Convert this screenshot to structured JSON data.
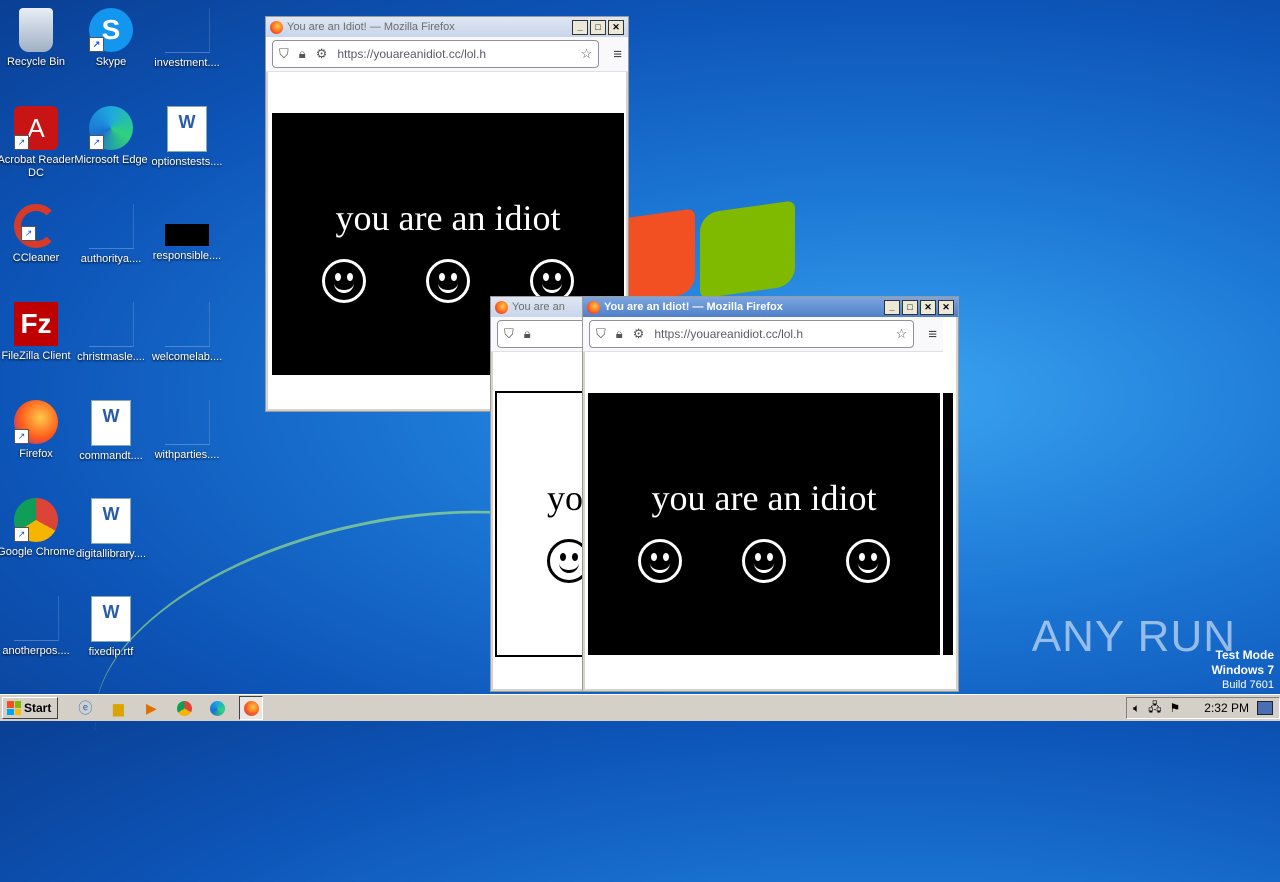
{
  "desktop": {
    "icons": [
      {
        "label": "Recycle Bin",
        "glyph": "recycle-bin-icon"
      },
      {
        "label": "Skype",
        "glyph": "skype-icon"
      },
      {
        "label": "investment....",
        "glyph": "blank-file-icon"
      },
      {
        "label": "Acrobat Reader DC",
        "glyph": "acrobat-icon"
      },
      {
        "label": "Microsoft Edge",
        "glyph": "edge-icon"
      },
      {
        "label": "optionstests....",
        "glyph": "word-doc-icon"
      },
      {
        "label": "CCleaner",
        "glyph": "ccleaner-icon"
      },
      {
        "label": "authorityа....",
        "glyph": "blank-file-icon"
      },
      {
        "label": "responsible....",
        "glyph": "black-file-icon"
      },
      {
        "label": "FileZilla Client",
        "glyph": "filezilla-icon"
      },
      {
        "label": "christmasle....",
        "glyph": "blank-file-icon"
      },
      {
        "label": "welcomelab....",
        "glyph": "blank-file-icon"
      },
      {
        "label": "Firefox",
        "glyph": "firefox-icon"
      },
      {
        "label": "commandt....",
        "glyph": "word-doc-icon"
      },
      {
        "label": "withparties....",
        "glyph": "blank-file-icon"
      },
      {
        "label": "Google Chrome",
        "glyph": "chrome-icon"
      },
      {
        "label": "digitallibrary....",
        "glyph": "word-doc-icon"
      },
      {
        "label": "anotherpos....",
        "glyph": "blank-file-icon"
      },
      {
        "label": "fixedip.rtf",
        "glyph": "word-doc-icon"
      }
    ]
  },
  "windows": {
    "back": {
      "title": "You are an Idiot! — Mozilla Firefox",
      "url": "https://youareanidiot.cc/lol.h",
      "message": "you are an idiot"
    },
    "middle": {
      "title": "You are an",
      "message": "yo"
    },
    "front": {
      "title": "You are an Idiot! — Mozilla Firefox",
      "url": "https://youareanidiot.cc/lol.h",
      "message": "you are an idiot"
    }
  },
  "taskbar": {
    "start_label": "Start",
    "clock": "2:32 PM"
  },
  "watermark": "ANY RUN",
  "test_mode": {
    "line1": "Test Mode",
    "line2": "Windows 7",
    "line3": "Build 7601"
  },
  "colors": {
    "desktop_blue": "#1d79d6",
    "titlebar_active": "#4f7fc8",
    "taskbar": "#d4d0c8"
  }
}
